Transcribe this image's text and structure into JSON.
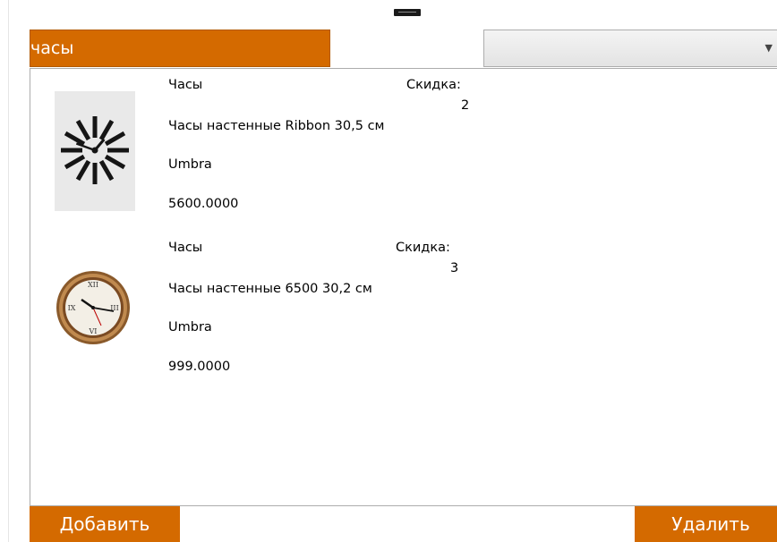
{
  "search": {
    "value": "часы"
  },
  "products": [
    {
      "category": "Часы",
      "name": "Часы настенные Ribbon 30,5 см",
      "manufacturer": "Umbra",
      "price": "5600.0000",
      "discount_label": "Скидка:",
      "discount": "2",
      "photo_icon": "starburst-wall-clock"
    },
    {
      "category": "Часы",
      "name": "Часы настенные 6500 30,2 см",
      "manufacturer": "Umbra",
      "price": "999.0000",
      "discount_label": "Скидка:",
      "discount": "3",
      "photo_icon": "round-bronze-wall-clock"
    }
  ],
  "buttons": {
    "add": "Добавить",
    "delete": "Удалить"
  },
  "colors": {
    "accent": "#d46a00",
    "border": "#acacac"
  }
}
